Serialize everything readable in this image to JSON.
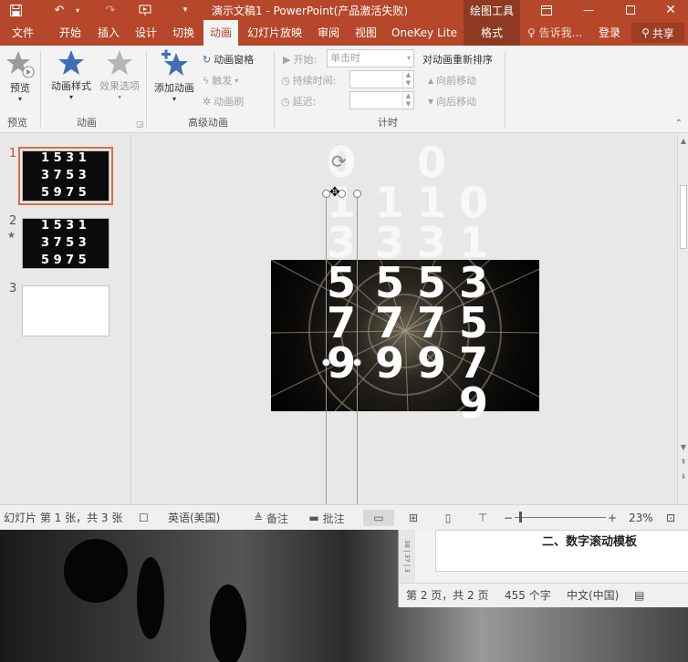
{
  "titlebar": {
    "title": "演示文稿1 - PowerPoint(产品激活失败)",
    "context_tools": "绘图工具",
    "save_icon": "save-icon",
    "undo_icon": "undo-icon",
    "redo_icon": "redo-icon",
    "present_icon": "present-icon",
    "customize_icon": "customize-qat-icon"
  },
  "tabs": [
    "文件",
    "开始",
    "插入",
    "设计",
    "切换",
    "动画",
    "幻灯片放映",
    "审阅",
    "视图",
    "OneKey Lite",
    "格式"
  ],
  "tabs_active": "动画",
  "tell_me": "告诉我...",
  "login": "登录",
  "share": "共享",
  "ribbon": {
    "preview": {
      "button": "预览",
      "group": "预览"
    },
    "animation": {
      "styles": "动画样式",
      "effect_options": "效果选项",
      "group": "动画"
    },
    "advanced": {
      "add": "添加动画",
      "pane": "动画窗格",
      "trigger": "触发",
      "painter": "动画刷",
      "group": "高级动画"
    },
    "timing": {
      "start_label": "开始:",
      "start_value": "单击时",
      "duration_label": "持续时间:",
      "delay_label": "延迟:",
      "reorder": "对动画重新排序",
      "move_earlier": "向前移动",
      "move_later": "向后移动",
      "group": "计时"
    }
  },
  "thumbnails": [
    {
      "num": "1",
      "rows": [
        "1 5 3 1",
        "3 7 5 3",
        "5 9 7 5"
      ]
    },
    {
      "num": "2",
      "rows": [
        "1 5 3 1",
        "3 7 5 3",
        "5 9 7 5"
      ]
    },
    {
      "num": "3",
      "rows": []
    }
  ],
  "slide": {
    "columns": [
      [
        "0",
        "1",
        "3",
        "5",
        "7",
        "9"
      ],
      [
        "1",
        "3",
        "5",
        "7",
        "9"
      ],
      [
        "0",
        "1",
        "3",
        "5",
        "7",
        "9"
      ],
      [
        "0",
        "1",
        "3",
        "5",
        "7",
        "9"
      ]
    ],
    "visible_rows": [
      "1 5 3 1",
      "3 7 5 3",
      "5 9 7 5"
    ]
  },
  "statusbar": {
    "slide_info": "幻灯片 第 1 张，共 3 张",
    "language": "英语(美国)",
    "notes": "备注",
    "comments": "批注",
    "zoom": "23%"
  },
  "word_window": {
    "heading": "二、数字滚动模板",
    "ruler": "38 | 37 | 3",
    "page_info": "第 2 页，共 2 页",
    "word_count": "455 个字",
    "language": "中文(中国)"
  }
}
